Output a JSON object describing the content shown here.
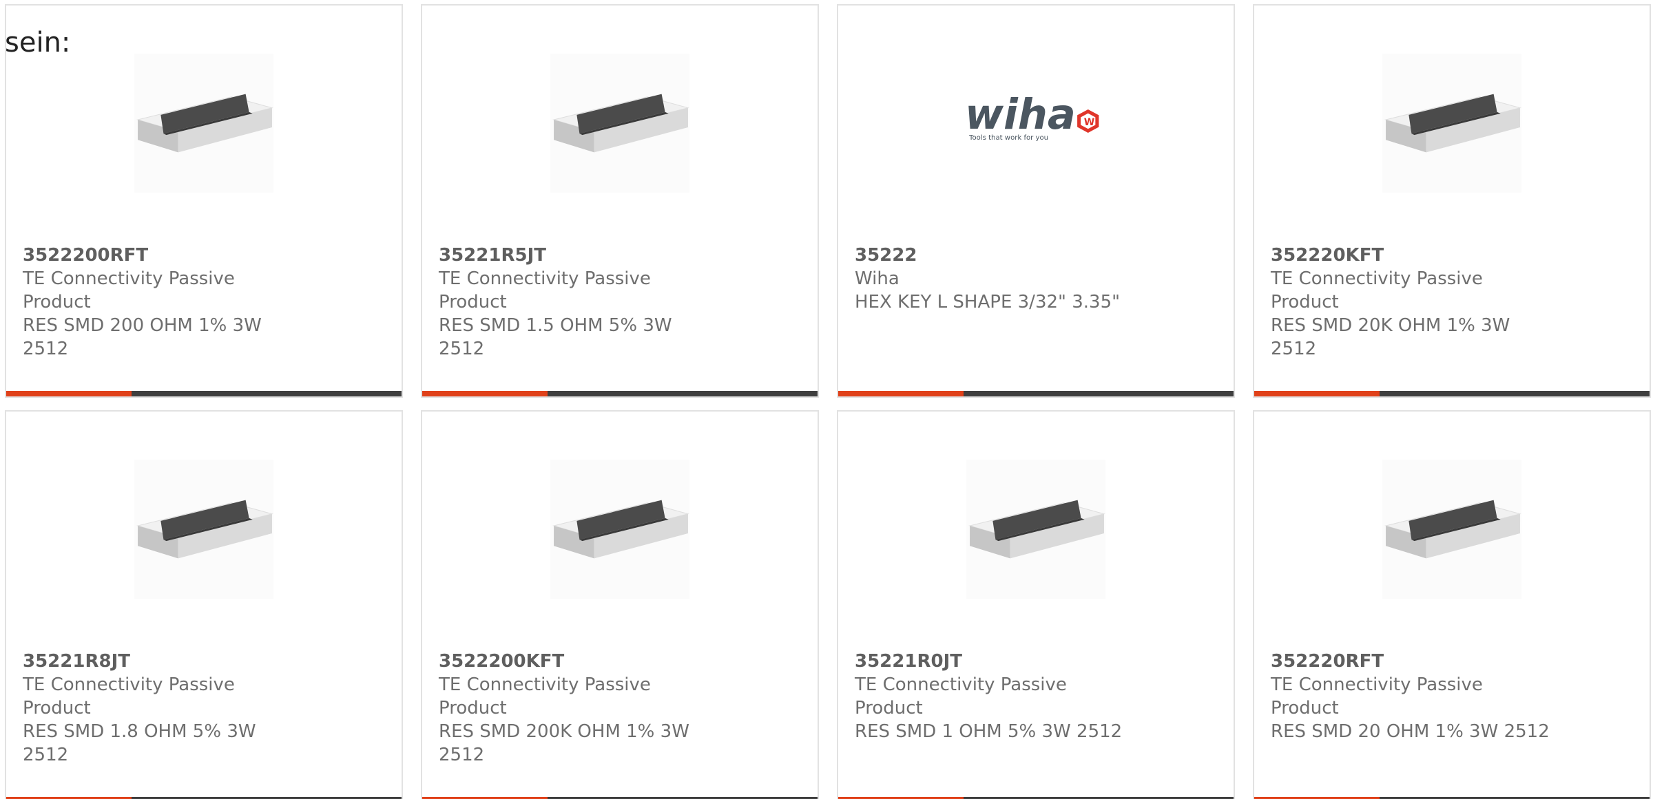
{
  "leading_text": "sein:",
  "colors": {
    "accent": "#e0411a",
    "bar": "#3f3f3f",
    "border": "#e2e2e2",
    "text": "#6e6e6e"
  },
  "products": [
    {
      "part": "3522200RFT",
      "manufacturer": "TE Connectivity Passive Product",
      "description": "RES SMD 200 OHM 1% 3W 2512",
      "image": "smd-resistor-icon"
    },
    {
      "part": "35221R5JT",
      "manufacturer": "TE Connectivity Passive Product",
      "description": "RES SMD 1.5 OHM 5% 3W 2512",
      "image": "smd-resistor-icon"
    },
    {
      "part": "35222",
      "manufacturer": "Wiha",
      "description": "HEX KEY L SHAPE 3/32\" 3.35\"",
      "image": "wiha-logo",
      "logo_text": "wiha",
      "logo_tagline": "Tools that work for you"
    },
    {
      "part": "352220KFT",
      "manufacturer": "TE Connectivity Passive Product",
      "description": "RES SMD 20K OHM 1% 3W 2512",
      "image": "smd-resistor-icon"
    },
    {
      "part": "35221R8JT",
      "manufacturer": "TE Connectivity Passive Product",
      "description": "RES SMD 1.8 OHM 5% 3W 2512",
      "image": "smd-resistor-icon"
    },
    {
      "part": "3522200KFT",
      "manufacturer": "TE Connectivity Passive Product",
      "description": "RES SMD 200K OHM 1% 3W 2512",
      "image": "smd-resistor-icon"
    },
    {
      "part": "35221R0JT",
      "manufacturer": "TE Connectivity Passive Product",
      "description": "RES SMD 1 OHM 5% 3W 2512",
      "image": "smd-resistor-icon"
    },
    {
      "part": "352220RFT",
      "manufacturer": "TE Connectivity Passive Product",
      "description": "RES SMD 20 OHM 1% 3W 2512",
      "image": "smd-resistor-icon"
    }
  ]
}
